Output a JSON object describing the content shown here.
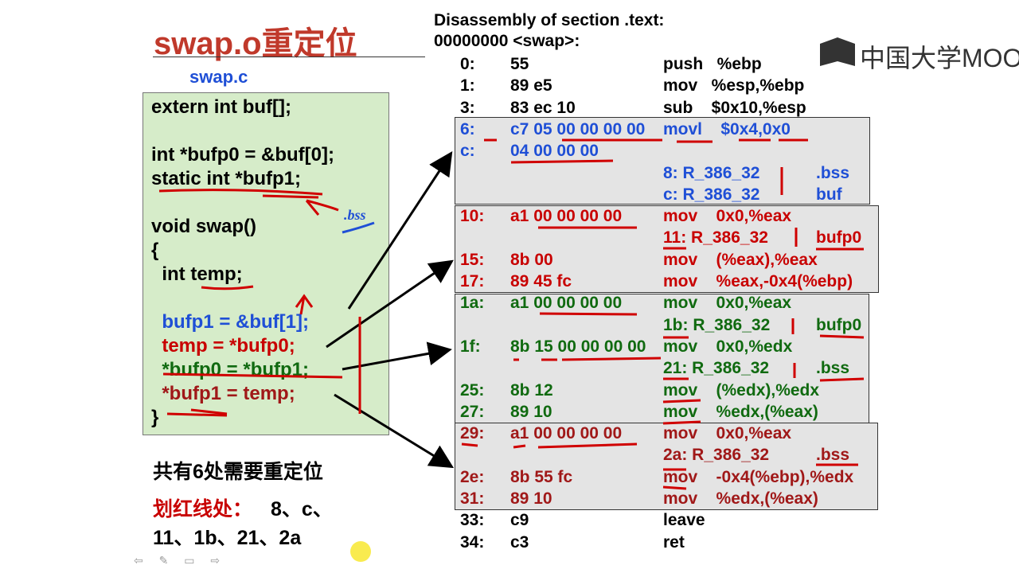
{
  "title": "swap.o重定位",
  "file_label": "swap.c",
  "code_lines": [
    {
      "text": "extern int buf[];",
      "color": "black"
    },
    {
      "text": "",
      "color": "black"
    },
    {
      "text": "int *bufp0 = &buf[0];",
      "color": "black"
    },
    {
      "text": "static int *bufp1;",
      "color": "black"
    },
    {
      "text": "",
      "color": "black"
    },
    {
      "text": "void swap()",
      "color": "black"
    },
    {
      "text": "{",
      "color": "black"
    },
    {
      "text": "  int temp;",
      "color": "black"
    },
    {
      "text": "",
      "color": "black"
    },
    {
      "text": "  bufp1 = &buf[1];",
      "color": "blue"
    },
    {
      "text": "  temp = *bufp0;",
      "color": "red"
    },
    {
      "text": "  *bufp0 = *bufp1;",
      "color": "green"
    },
    {
      "text": "  *bufp1 = temp;",
      "color": "dred"
    },
    {
      "text": "}",
      "color": "black"
    }
  ],
  "annotation_bss": ".bss",
  "summary": "共有6处需要重定位",
  "marked_label": "划红线处：",
  "marked_items_1": "8、c、",
  "marked_items_2": "11、1b、21、2a",
  "disasm": {
    "header1": "Disassembly of section .text:",
    "header2": "00000000 <swap>:",
    "lines": [
      {
        "addr": "0:",
        "bytes": "55",
        "instr": "push   %ebp",
        "reloc": "",
        "sym": "",
        "color": "black"
      },
      {
        "addr": "1:",
        "bytes": "89 e5",
        "instr": "mov   %esp,%ebp",
        "reloc": "",
        "sym": "",
        "color": "black"
      },
      {
        "addr": "3:",
        "bytes": "83 ec 10",
        "instr": "sub    $0x10,%esp",
        "reloc": "",
        "sym": "",
        "color": "black"
      },
      {
        "addr": "6:",
        "bytes": "c7 05 00 00 00 00",
        "instr": "movl    $0x4,0x0",
        "reloc": "",
        "sym": "",
        "color": "blue"
      },
      {
        "addr": "c:",
        "bytes": "04 00 00 00",
        "instr": "",
        "reloc": "",
        "sym": "",
        "color": "blue"
      },
      {
        "addr": "",
        "bytes": "",
        "instr": "",
        "reloc": "8: R_386_32",
        "sym": ".bss",
        "color": "blue"
      },
      {
        "addr": "",
        "bytes": "",
        "instr": "",
        "reloc": "c: R_386_32",
        "sym": "buf",
        "color": "blue"
      },
      {
        "addr": "10:",
        "bytes": "a1 00 00 00 00",
        "instr": "mov    0x0,%eax",
        "reloc": "",
        "sym": "",
        "color": "red"
      },
      {
        "addr": "",
        "bytes": "",
        "instr": "",
        "reloc": "11: R_386_32",
        "sym": "bufp0",
        "color": "red"
      },
      {
        "addr": "15:",
        "bytes": "8b 00",
        "instr": "mov    (%eax),%eax",
        "reloc": "",
        "sym": "",
        "color": "red"
      },
      {
        "addr": "17:",
        "bytes": "89 45 fc",
        "instr": "mov    %eax,-0x4(%ebp)",
        "reloc": "",
        "sym": "",
        "color": "red"
      },
      {
        "addr": "1a:",
        "bytes": "a1 00 00 00 00",
        "instr": "mov    0x0,%eax",
        "reloc": "",
        "sym": "",
        "color": "green"
      },
      {
        "addr": "",
        "bytes": "",
        "instr": "",
        "reloc": "1b: R_386_32",
        "sym": "bufp0",
        "color": "green"
      },
      {
        "addr": "1f:",
        "bytes": "8b 15 00 00 00 00",
        "instr": "mov    0x0,%edx",
        "reloc": "",
        "sym": "",
        "color": "green"
      },
      {
        "addr": "",
        "bytes": "",
        "instr": "",
        "reloc": "21: R_386_32",
        "sym": ".bss",
        "color": "green"
      },
      {
        "addr": "25:",
        "bytes": "8b 12",
        "instr": "mov    (%edx),%edx",
        "reloc": "",
        "sym": "",
        "color": "green"
      },
      {
        "addr": "27:",
        "bytes": "89 10",
        "instr": "mov    %edx,(%eax)",
        "reloc": "",
        "sym": "",
        "color": "green"
      },
      {
        "addr": "29:",
        "bytes": "a1 00 00 00 00",
        "instr": "mov    0x0,%eax",
        "reloc": "",
        "sym": "",
        "color": "dred"
      },
      {
        "addr": "",
        "bytes": "",
        "instr": "",
        "reloc": "2a: R_386_32",
        "sym": ".bss",
        "color": "dred"
      },
      {
        "addr": "2e:",
        "bytes": "8b 55 fc",
        "instr": "mov    -0x4(%ebp),%edx",
        "reloc": "",
        "sym": "",
        "color": "dred"
      },
      {
        "addr": "31:",
        "bytes": "89 10",
        "instr": "mov    %edx,(%eax)",
        "reloc": "",
        "sym": "",
        "color": "dred"
      },
      {
        "addr": "33:",
        "bytes": "c9",
        "instr": "leave",
        "reloc": "",
        "sym": "",
        "color": "black"
      },
      {
        "addr": "34:",
        "bytes": "c3",
        "instr": "ret",
        "reloc": "",
        "sym": "",
        "color": "black"
      }
    ]
  },
  "logo_text": "中国大学MOOC",
  "nav_glyphs": "⇦ ✎ ▭ ⇨",
  "colors": {
    "title": "#c0392b",
    "blue": "#1f4fd6",
    "red": "#c80000",
    "green": "#106a10",
    "dred": "#a01818",
    "code_bg": "#d6ecc9",
    "box_bg": "#e4e4e4"
  }
}
